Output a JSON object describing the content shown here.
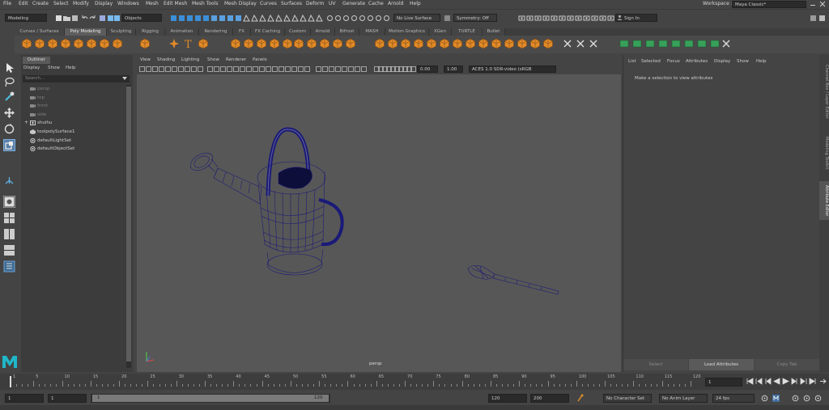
{
  "menubar": {
    "items": [
      "File",
      "Edit",
      "Create",
      "Select",
      "Modify",
      "Display",
      "Windows",
      "Mesh",
      "Edit Mesh",
      "Mesh Tools",
      "Mesh Display",
      "Curves",
      "Surfaces",
      "Deform",
      "UV",
      "Generate",
      "Cache",
      "Arnold",
      "Help"
    ],
    "workspace_label": "Workspace :",
    "workspace_value": "Maya Classic*"
  },
  "statusline": {
    "mode_value": "Modeling",
    "objects_value": "Objects",
    "live_surface": "No Live Surface",
    "symmetry": "Symmetry: Off",
    "sign_in": "Sign In"
  },
  "shelf_tabs": [
    {
      "label": "Curves / Surfaces",
      "active": false
    },
    {
      "label": "Poly Modeling",
      "active": true
    },
    {
      "label": "Sculpting",
      "active": false
    },
    {
      "label": "Rigging",
      "active": false
    },
    {
      "label": "Animation",
      "active": false
    },
    {
      "label": "Rendering",
      "active": false
    },
    {
      "label": "FX",
      "active": false
    },
    {
      "label": "FX Caching",
      "active": false
    },
    {
      "label": "Custom",
      "active": false
    },
    {
      "label": "Arnold",
      "active": false
    },
    {
      "label": "Bifrost",
      "active": false
    },
    {
      "label": "MASH",
      "active": false
    },
    {
      "label": "Motion Graphics",
      "active": false
    },
    {
      "label": "XGen",
      "active": false
    },
    {
      "label": "TURTLE",
      "active": false
    },
    {
      "label": "Bullet",
      "active": false
    }
  ],
  "outliner": {
    "title": "Outliner",
    "menu": [
      "Display",
      "Show",
      "Help"
    ],
    "search_placeholder": "Search...",
    "items": [
      {
        "label": "persp",
        "icon": "camera-icon",
        "dim": true
      },
      {
        "label": "top",
        "icon": "camera-icon",
        "dim": true
      },
      {
        "label": "front",
        "icon": "camera-icon",
        "dim": true
      },
      {
        "label": "side",
        "icon": "camera-icon",
        "dim": true
      },
      {
        "label": "shuihu",
        "icon": "group-icon",
        "dim": false
      },
      {
        "label": "toolpolySurface1",
        "icon": "mesh-icon",
        "dim": false
      },
      {
        "label": "defaultLightSet",
        "icon": "set-icon",
        "dim": false
      },
      {
        "label": "defaultObjectSet",
        "icon": "set-icon",
        "dim": false
      }
    ]
  },
  "viewport": {
    "menu": [
      "View",
      "Shading",
      "Lighting",
      "Show",
      "Renderer",
      "Panels"
    ],
    "exposure": "0.00",
    "gamma": "1.00",
    "color_space": "ACES 1.0 SDR-video (sRGB",
    "camera_label": "persp",
    "bg_color": "#575757",
    "wire_color": "#1a1a78"
  },
  "attribute_editor": {
    "menu": [
      "List",
      "Selected",
      "Focus",
      "Attributes",
      "Display",
      "Show",
      "Help"
    ],
    "message": "Make a selection to view attributes",
    "buttons": [
      {
        "label": "Select",
        "active": false
      },
      {
        "label": "Load Attributes",
        "active": true
      },
      {
        "label": "Copy Tab",
        "active": false
      }
    ]
  },
  "side_tabs": [
    "Channel Box / Layer Editor",
    "Modeling Toolkit",
    "Attribute Editor"
  ],
  "timeline": {
    "ticks": [
      "1",
      "5",
      "10",
      "15",
      "20",
      "25",
      "30",
      "35",
      "40",
      "45",
      "50",
      "55",
      "60",
      "65",
      "70",
      "75",
      "80",
      "85",
      "90",
      "95",
      "100",
      "105",
      "110",
      "115",
      "120"
    ],
    "current_frame": "1"
  },
  "range": {
    "start": "1",
    "playback_start": "1",
    "slider_start": "1",
    "slider_end": "120",
    "playback_end": "120",
    "end": "200",
    "character_set": "No Character Set",
    "anim_layer": "No Anim Layer",
    "fps": "24 fps"
  }
}
